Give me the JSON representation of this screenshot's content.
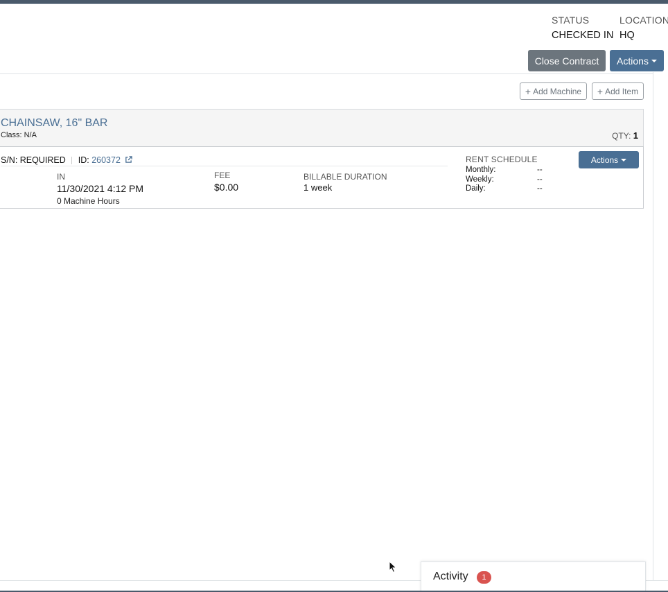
{
  "contract": {
    "status_label": "STATUS",
    "status_value": "CHECKED IN",
    "location_label": "LOCATION",
    "location_value": "HQ"
  },
  "toolbar": {
    "close_contract": "Close Contract",
    "actions": "Actions"
  },
  "panel": {
    "add_machine": "Add Machine",
    "add_item": "Add Item"
  },
  "item": {
    "title": "CHAINSAW, 16\" BAR",
    "class": "Class: N/A",
    "qty_label": "QTY:",
    "qty_value": "1",
    "sn": "S/N: REQUIRED",
    "id_label": "ID:",
    "id_value": "260372",
    "in_label": "IN",
    "in_value": "11/30/2021 4:12 PM",
    "hours": "0 Machine Hours",
    "fee_label": "FEE",
    "fee_value": "$0.00",
    "duration_label": "BILLABLE DURATION",
    "duration_value": "1 week",
    "actions": "Actions",
    "rent_schedule": {
      "title": "RENT SCHEDULE",
      "rows": [
        {
          "label": "Monthly:",
          "value": "--"
        },
        {
          "label": "Weekly:",
          "value": "--"
        },
        {
          "label": "Daily:",
          "value": "--"
        }
      ]
    }
  },
  "activity": {
    "label": "Activity",
    "count": "1"
  },
  "colors": {
    "accent": "#4a6f94",
    "secondary": "#6c757d",
    "badge": "#d9534f"
  }
}
